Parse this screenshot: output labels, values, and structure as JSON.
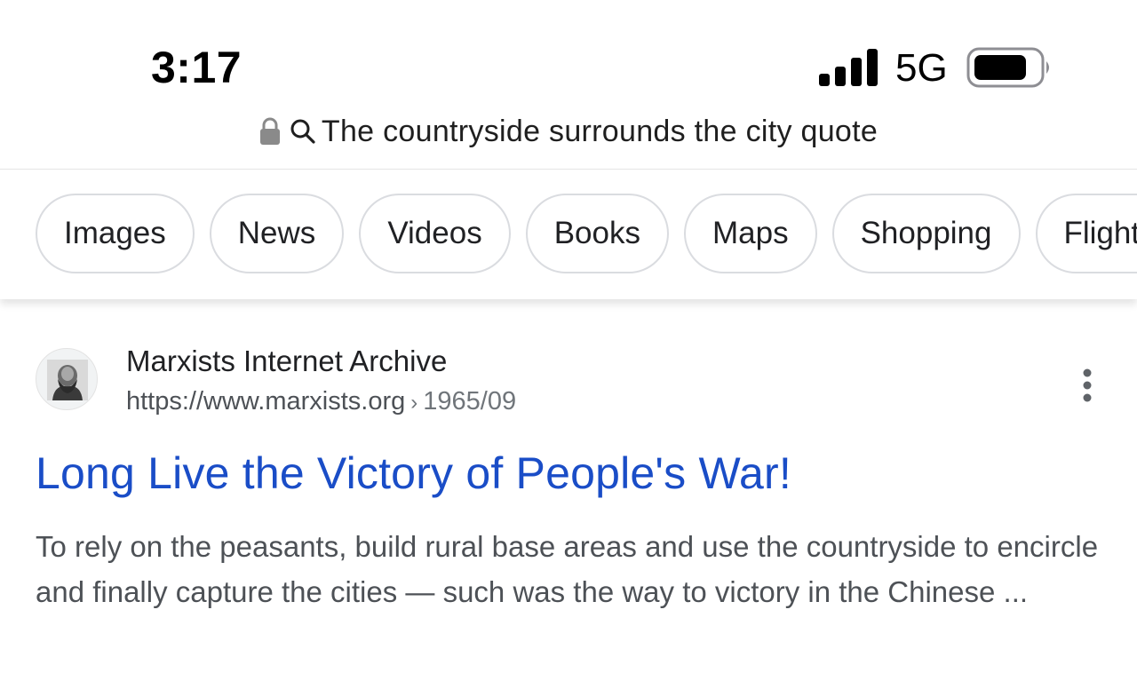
{
  "status_bar": {
    "time": "3:17",
    "network": "5G",
    "icons": [
      "signal-icon",
      "battery-icon"
    ]
  },
  "address_bar": {
    "query": "The countryside surrounds the city quote",
    "icons": [
      "lock-icon",
      "search-icon"
    ]
  },
  "filter_chips": [
    {
      "label": "Images"
    },
    {
      "label": "News"
    },
    {
      "label": "Videos"
    },
    {
      "label": "Books"
    },
    {
      "label": "Maps"
    },
    {
      "label": "Shopping"
    },
    {
      "label": "Flights"
    }
  ],
  "result": {
    "site_name": "Marxists Internet Archive",
    "url": "https://www.marxists.org",
    "breadcrumb_separator": "›",
    "path": "1965/09",
    "title": "Long Live the Victory of People's War!",
    "snippet": "To rely on the peasants, build rural base areas and use the countryside to encircle and finally capture the cities — such was the way to victory in the Chinese ...",
    "icons": [
      "site-favicon",
      "more-options-icon"
    ]
  },
  "colors": {
    "link": "#1a4dc7",
    "text_secondary": "#4d5156",
    "chip_border": "#dadce0"
  }
}
